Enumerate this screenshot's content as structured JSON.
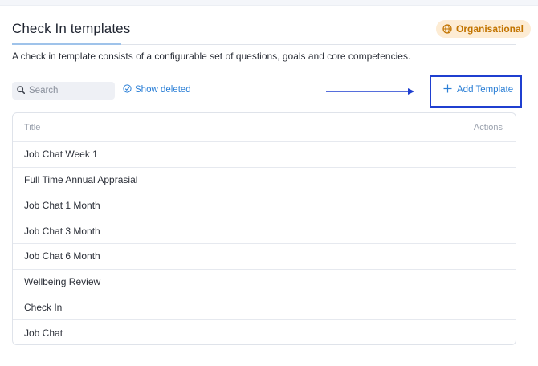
{
  "header": {
    "title": "Check In templates",
    "badge": "Organisational",
    "description": "A check in template consists of a configurable set of questions, goals and core competencies."
  },
  "toolbar": {
    "search_placeholder": "Search",
    "show_deleted_label": "Show deleted",
    "add_template_label": "Add Template"
  },
  "table": {
    "columns": [
      "Title",
      "Actions"
    ],
    "rows": [
      "Job Chat Week 1",
      "Full Time Annual Apprasial",
      "Job Chat 1 Month",
      "Job Chat 3 Month",
      "Job Chat 6 Month",
      "Wellbeing Review",
      "Check In",
      "Job Chat"
    ]
  },
  "colors": {
    "accent": "#2b7fd6",
    "badge_bg": "#fdecd4",
    "badge_text": "#c27400",
    "highlight": "#1f3fd0"
  },
  "icons": {
    "badge": "globe-icon",
    "search": "search-icon",
    "show_deleted": "check-circle-icon",
    "add": "plus-icon"
  }
}
